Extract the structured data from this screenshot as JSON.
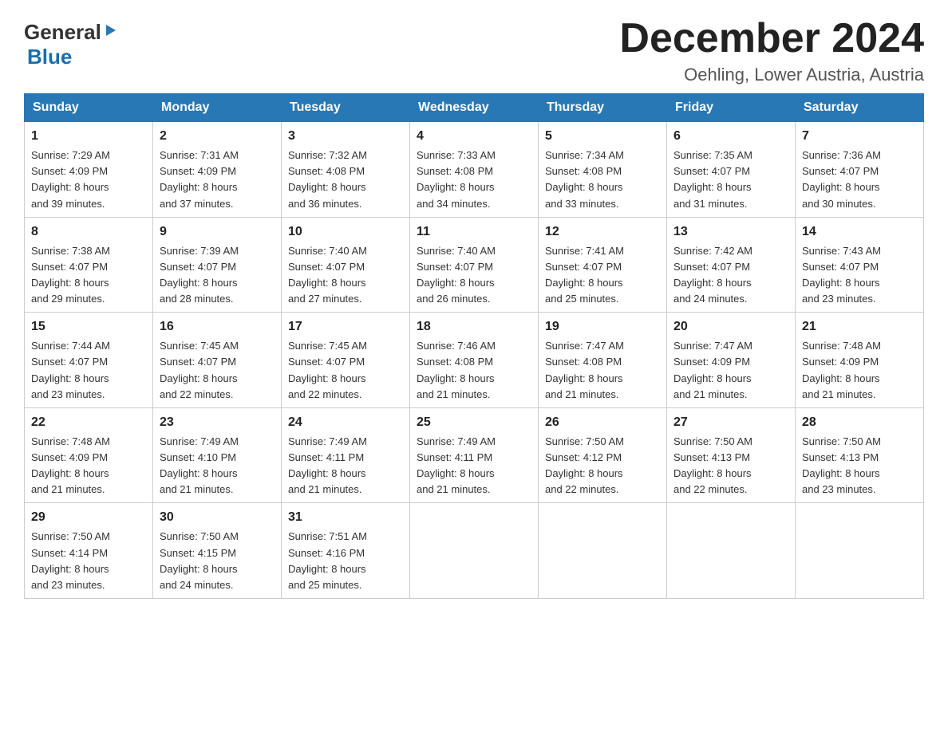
{
  "header": {
    "logo_general": "General",
    "logo_blue": "Blue",
    "month_title": "December 2024",
    "location": "Oehling, Lower Austria, Austria"
  },
  "weekdays": [
    "Sunday",
    "Monday",
    "Tuesday",
    "Wednesday",
    "Thursday",
    "Friday",
    "Saturday"
  ],
  "weeks": [
    [
      {
        "day": "1",
        "sunrise": "7:29 AM",
        "sunset": "4:09 PM",
        "daylight": "8 hours and 39 minutes."
      },
      {
        "day": "2",
        "sunrise": "7:31 AM",
        "sunset": "4:09 PM",
        "daylight": "8 hours and 37 minutes."
      },
      {
        "day": "3",
        "sunrise": "7:32 AM",
        "sunset": "4:08 PM",
        "daylight": "8 hours and 36 minutes."
      },
      {
        "day": "4",
        "sunrise": "7:33 AM",
        "sunset": "4:08 PM",
        "daylight": "8 hours and 34 minutes."
      },
      {
        "day": "5",
        "sunrise": "7:34 AM",
        "sunset": "4:08 PM",
        "daylight": "8 hours and 33 minutes."
      },
      {
        "day": "6",
        "sunrise": "7:35 AM",
        "sunset": "4:07 PM",
        "daylight": "8 hours and 31 minutes."
      },
      {
        "day": "7",
        "sunrise": "7:36 AM",
        "sunset": "4:07 PM",
        "daylight": "8 hours and 30 minutes."
      }
    ],
    [
      {
        "day": "8",
        "sunrise": "7:38 AM",
        "sunset": "4:07 PM",
        "daylight": "8 hours and 29 minutes."
      },
      {
        "day": "9",
        "sunrise": "7:39 AM",
        "sunset": "4:07 PM",
        "daylight": "8 hours and 28 minutes."
      },
      {
        "day": "10",
        "sunrise": "7:40 AM",
        "sunset": "4:07 PM",
        "daylight": "8 hours and 27 minutes."
      },
      {
        "day": "11",
        "sunrise": "7:40 AM",
        "sunset": "4:07 PM",
        "daylight": "8 hours and 26 minutes."
      },
      {
        "day": "12",
        "sunrise": "7:41 AM",
        "sunset": "4:07 PM",
        "daylight": "8 hours and 25 minutes."
      },
      {
        "day": "13",
        "sunrise": "7:42 AM",
        "sunset": "4:07 PM",
        "daylight": "8 hours and 24 minutes."
      },
      {
        "day": "14",
        "sunrise": "7:43 AM",
        "sunset": "4:07 PM",
        "daylight": "8 hours and 23 minutes."
      }
    ],
    [
      {
        "day": "15",
        "sunrise": "7:44 AM",
        "sunset": "4:07 PM",
        "daylight": "8 hours and 23 minutes."
      },
      {
        "day": "16",
        "sunrise": "7:45 AM",
        "sunset": "4:07 PM",
        "daylight": "8 hours and 22 minutes."
      },
      {
        "day": "17",
        "sunrise": "7:45 AM",
        "sunset": "4:07 PM",
        "daylight": "8 hours and 22 minutes."
      },
      {
        "day": "18",
        "sunrise": "7:46 AM",
        "sunset": "4:08 PM",
        "daylight": "8 hours and 21 minutes."
      },
      {
        "day": "19",
        "sunrise": "7:47 AM",
        "sunset": "4:08 PM",
        "daylight": "8 hours and 21 minutes."
      },
      {
        "day": "20",
        "sunrise": "7:47 AM",
        "sunset": "4:09 PM",
        "daylight": "8 hours and 21 minutes."
      },
      {
        "day": "21",
        "sunrise": "7:48 AM",
        "sunset": "4:09 PM",
        "daylight": "8 hours and 21 minutes."
      }
    ],
    [
      {
        "day": "22",
        "sunrise": "7:48 AM",
        "sunset": "4:09 PM",
        "daylight": "8 hours and 21 minutes."
      },
      {
        "day": "23",
        "sunrise": "7:49 AM",
        "sunset": "4:10 PM",
        "daylight": "8 hours and 21 minutes."
      },
      {
        "day": "24",
        "sunrise": "7:49 AM",
        "sunset": "4:11 PM",
        "daylight": "8 hours and 21 minutes."
      },
      {
        "day": "25",
        "sunrise": "7:49 AM",
        "sunset": "4:11 PM",
        "daylight": "8 hours and 21 minutes."
      },
      {
        "day": "26",
        "sunrise": "7:50 AM",
        "sunset": "4:12 PM",
        "daylight": "8 hours and 22 minutes."
      },
      {
        "day": "27",
        "sunrise": "7:50 AM",
        "sunset": "4:13 PM",
        "daylight": "8 hours and 22 minutes."
      },
      {
        "day": "28",
        "sunrise": "7:50 AM",
        "sunset": "4:13 PM",
        "daylight": "8 hours and 23 minutes."
      }
    ],
    [
      {
        "day": "29",
        "sunrise": "7:50 AM",
        "sunset": "4:14 PM",
        "daylight": "8 hours and 23 minutes."
      },
      {
        "day": "30",
        "sunrise": "7:50 AM",
        "sunset": "4:15 PM",
        "daylight": "8 hours and 24 minutes."
      },
      {
        "day": "31",
        "sunrise": "7:51 AM",
        "sunset": "4:16 PM",
        "daylight": "8 hours and 25 minutes."
      },
      null,
      null,
      null,
      null
    ]
  ],
  "labels": {
    "sunrise": "Sunrise:",
    "sunset": "Sunset:",
    "daylight": "Daylight:"
  }
}
